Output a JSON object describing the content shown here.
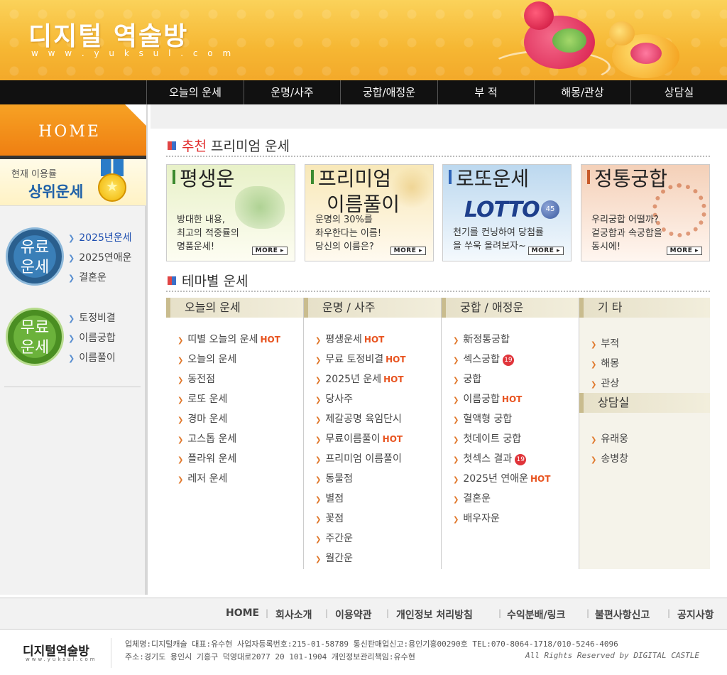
{
  "header": {
    "logo_title": "디지털 역술방",
    "logo_url": "w w w . y u k s u l . c o m"
  },
  "nav": [
    "오늘의 운세",
    "운명/사주",
    "궁합/애정운",
    "부 적",
    "해몽/관상",
    "상담실"
  ],
  "sidebar": {
    "home_label": "HOME",
    "rank_small": "현재 이용률",
    "rank_big": "상위운세",
    "paid_badge": [
      "유료",
      "운세"
    ],
    "free_badge": [
      "무료",
      "운세"
    ],
    "paid_links": [
      "2025년운세",
      "2025연애운",
      "결혼운"
    ],
    "free_links": [
      "토정비결",
      "이름궁합",
      "이름풀이"
    ]
  },
  "premium": {
    "title_red": "추천",
    "title": "프리미엄 운세",
    "cards": [
      {
        "title": "평생운",
        "desc": [
          "방대한 내용,",
          "최고의 적중률의",
          "명품운세!"
        ],
        "more": "MORE ▸"
      },
      {
        "title": "프리미엄",
        "title2": "이름풀이",
        "desc": [
          "운명의 30%를",
          "좌우한다는 이름!",
          "당신의 이름은?"
        ],
        "more": "MORE ▸"
      },
      {
        "title": "로또운세",
        "logo": "LOTTO",
        "ball": "45",
        "desc": [
          "천기를 컨닝하여 당첨률",
          "을 쑤욱 올려보자~"
        ],
        "more": "MORE ▸"
      },
      {
        "title": "정통궁합",
        "desc": [
          "우리궁합 어떨까?",
          "겉궁합과 속궁합을",
          "동시에!"
        ],
        "more": "MORE ▸"
      }
    ]
  },
  "theme": {
    "title": "테마별 운세",
    "hot": "HOT",
    "badge19": "19",
    "columns": [
      {
        "head": "오늘의 운세",
        "items": [
          {
            "label": "띠별 오늘의 운세",
            "hot": true
          },
          {
            "label": "오늘의 운세"
          },
          {
            "label": "동전점"
          },
          {
            "label": "로또 운세"
          },
          {
            "label": "경마 운세"
          },
          {
            "label": "고스톱 운세"
          },
          {
            "label": "플라워 운세"
          },
          {
            "label": "레저 운세"
          }
        ]
      },
      {
        "head": "운명 / 사주",
        "items": [
          {
            "label": "평생운세",
            "hot": true
          },
          {
            "label": "무료 토정비결",
            "hot": true
          },
          {
            "label": "2025년 운세",
            "hot": true
          },
          {
            "label": "당사주"
          },
          {
            "label": "제갈공명 육임단시"
          },
          {
            "label": "무료이름풀이",
            "hot": true
          },
          {
            "label": "프리미엄 이름풀이"
          },
          {
            "label": "동물점"
          },
          {
            "label": "별점"
          },
          {
            "label": "꽃점"
          },
          {
            "label": "주간운"
          },
          {
            "label": "월간운"
          }
        ]
      },
      {
        "head": "궁합 / 애정운",
        "items": [
          {
            "label": "新정통궁합"
          },
          {
            "label": "섹스궁합",
            "b19": true
          },
          {
            "label": "궁합"
          },
          {
            "label": "이름궁합",
            "hot": true
          },
          {
            "label": "혈액형 궁합"
          },
          {
            "label": "첫데이트 궁합"
          },
          {
            "label": "첫섹스 결과",
            "b19": true
          },
          {
            "label": "2025년 연애운",
            "hot": true
          },
          {
            "label": "결혼운"
          },
          {
            "label": "배우자운"
          }
        ]
      },
      {
        "head": "기   타",
        "items": [
          {
            "label": "부적"
          },
          {
            "label": "해몽"
          },
          {
            "label": "관상"
          }
        ],
        "sub_head": "상담실",
        "sub_items": [
          {
            "label": "유래웅"
          },
          {
            "label": "송병창"
          }
        ]
      }
    ]
  },
  "footer": {
    "links": [
      "HOME",
      "회사소개",
      "이용약관",
      "개인정보 처리방침",
      "수익분배/링크",
      "불편사항신고",
      "공지사항"
    ],
    "logo": "디지털역술방",
    "logo_url": "www.yuksul.com",
    "line1": "업체명:디지털캐슬 대표:유수현 사업자등록번호:215-01-58789 통신판매업신고:용인기흥00290호 TEL:070-8064-1718/010-5246-4096",
    "line2": "주소:경기도 용인시 기흥구 덕영대로2077 20 101-1904  개인정보관리책임:유수현",
    "copyright": "All Rights Reserved by DIGITAL CASTLE"
  },
  "colors": {
    "accent_orange": "#f3a92a",
    "nav_bg": "#111111",
    "hot_red": "#e8531f",
    "link_blue": "#1f4fb0"
  }
}
